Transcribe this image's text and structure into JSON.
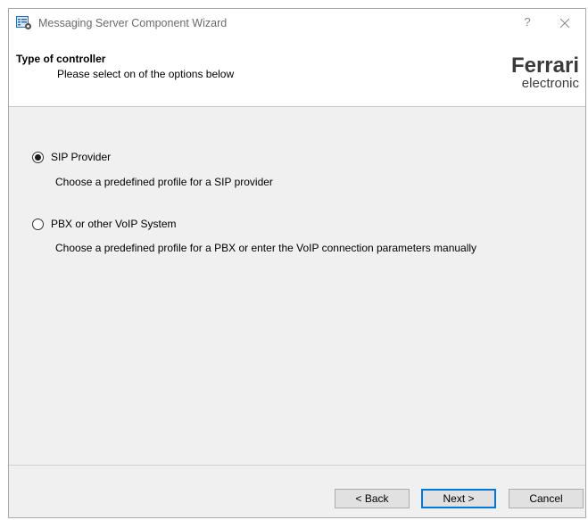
{
  "window": {
    "title": "Messaging Server Component Wizard",
    "help_label": "?"
  },
  "header": {
    "title": "Type of controller",
    "subtitle": "Please select on of the options below",
    "logo": {
      "word_primary": "Ferrari",
      "word_secondary": "electronic"
    }
  },
  "options": [
    {
      "label": "SIP Provider",
      "description": "Choose a predefined profile for a SIP provider",
      "checked": true
    },
    {
      "label": "PBX or other VoIP System",
      "description": "Choose a predefined profile for a PBX or enter the VoIP connection parameters manually",
      "checked": false
    }
  ],
  "footer": {
    "back_label": "< Back",
    "next_label": "Next >",
    "cancel_label": "Cancel"
  },
  "colors": {
    "window_bg": "#f0f0f0",
    "panel_bg": "#ffffff",
    "default_button_border": "#0078d7",
    "button_bg": "#e1e1e1"
  }
}
